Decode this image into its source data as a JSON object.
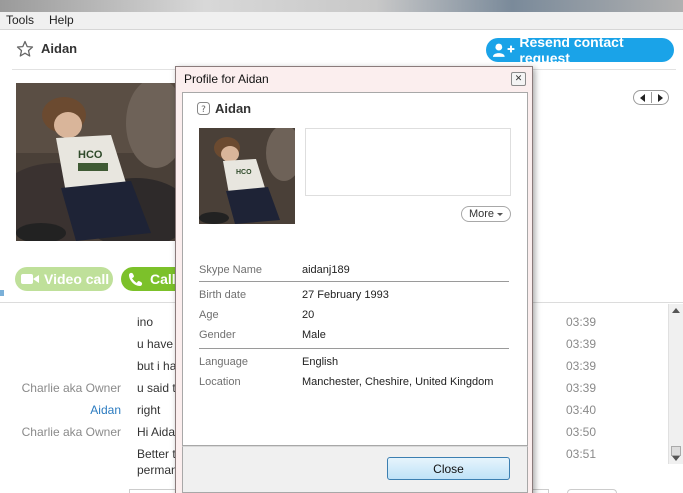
{
  "menubar": {
    "items": [
      {
        "label": "Tools"
      },
      {
        "label": "Help"
      }
    ]
  },
  "contact": {
    "name": "Aidan"
  },
  "header": {
    "resend_label": "Resend contact request"
  },
  "call_buttons": {
    "video_label": "Video call",
    "call_label": "Call"
  },
  "chat": {
    "messages": [
      {
        "sender": "",
        "text": "ino",
        "time": "03:39"
      },
      {
        "sender": "",
        "text": "u have",
        "time": "03:39"
      },
      {
        "sender": "",
        "text": "but i hav",
        "time": "03:39"
      },
      {
        "sender": "Charlie aka Owner",
        "text": "u said th",
        "time": "03:39"
      },
      {
        "sender": "Aidan",
        "text": "right",
        "time": "03:40"
      },
      {
        "sender": "Charlie aka Owner",
        "text": "Hi Aidan",
        "time": "03:50"
      },
      {
        "sender": "",
        "text": "Better th",
        "text2": "permant",
        "time": "03:51"
      }
    ]
  },
  "profile_dialog": {
    "title": "Profile for Aidan",
    "name": "Aidan",
    "more_label": "More",
    "close_label": "Close",
    "fields": [
      {
        "label": "Skype Name",
        "value": "aidanj189"
      },
      {
        "label": "Birth date",
        "value": "27 February 1993"
      },
      {
        "label": "Age",
        "value": "20"
      },
      {
        "label": "Gender",
        "value": "Male"
      },
      {
        "label": "Language",
        "value": "English"
      },
      {
        "label": "Location",
        "value": "Manchester, Cheshire, United Kingdom"
      }
    ]
  },
  "colors": {
    "accent": "#1aa3e8",
    "call_green": "#7cc12a",
    "video_green_disabled": "#bfe09a",
    "self_sender": "#2b7bc0"
  }
}
